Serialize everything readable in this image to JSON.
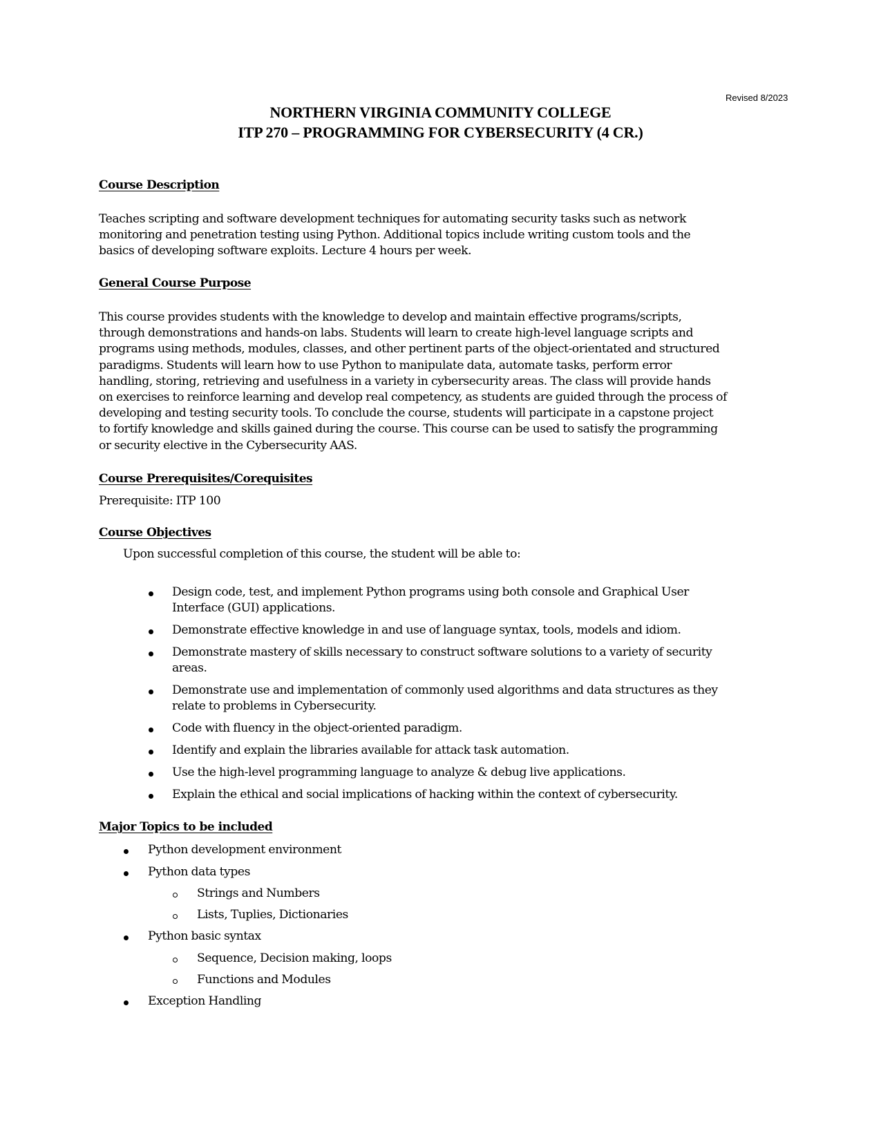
{
  "revised": "Revised 8/2023",
  "header": {
    "college": "NORTHERN VIRGINIA COMMUNITY COLLEGE",
    "course": "ITP 270 – PROGRAMMING FOR CYBERSECURITY (4 CR.)"
  },
  "description": {
    "heading": "Course Description",
    "lines": [
      "Teaches scripting and software development techniques for automating security tasks such as network",
      "monitoring and penetration testing using Python.  Additional topics include writing custom tools and the",
      "basics of developing software exploits. Lecture 4 hours per week."
    ]
  },
  "purpose": {
    "heading": "General Course Purpose",
    "lines": [
      "This course provides students with the knowledge to develop and maintain effective programs/scripts,",
      "through demonstrations and hands-on labs. Students will learn to create high-level language scripts and",
      "programs using methods, modules, classes, and other pertinent parts of the object-orientated and structured",
      "paradigms. Students will learn how to use Python to manipulate data, automate tasks, perform error",
      "handling, storing, retrieving and usefulness in a variety in cybersecurity areas. The class will provide hands",
      "on exercises to reinforce learning and develop real competency, as students are guided through the process of",
      "developing and testing security tools.  To conclude the course, students will participate in a capstone project",
      "to fortify knowledge and skills gained during the course.  This course can be used to satisfy the programming",
      "or security elective in the Cybersecurity AAS."
    ]
  },
  "prerequisites": {
    "heading": "Course Prerequisites/Corequisites",
    "text": "Prerequisite: ITP 100"
  },
  "objectives": {
    "heading": "Course Objectives",
    "intro": "Upon successful completion of this course, the student will be able to:",
    "items": [
      [
        "Design code, test, and implement Python programs using both console and Graphical User",
        "Interface (GUI) applications."
      ],
      [
        "Demonstrate effective knowledge in and use of language syntax, tools, models and idiom."
      ],
      [
        "Demonstrate mastery of skills necessary to construct software solutions to a variety of security",
        "areas."
      ],
      [
        "Demonstrate use and implementation of commonly used algorithms and data structures as they",
        "relate to problems in Cybersecurity."
      ],
      [
        "Code with fluency in the object-oriented paradigm."
      ],
      [
        "Identify and explain the libraries available for attack task automation."
      ],
      [
        "Use the high-level programming language to analyze & debug live applications."
      ],
      [
        "Explain the ethical and social implications of hacking within the context of cybersecurity."
      ]
    ]
  },
  "topics": {
    "heading": "Major Topics to be included",
    "items": [
      {
        "label": "Python development environment",
        "sub": []
      },
      {
        "label": "Python data types",
        "sub": [
          "Strings and Numbers",
          "Lists, Tuplies, Dictionaries"
        ]
      },
      {
        "label": "Python basic syntax",
        "sub": [
          "Sequence, Decision making, loops",
          "Functions and Modules"
        ]
      },
      {
        "label": "Exception Handling",
        "sub": []
      }
    ]
  }
}
